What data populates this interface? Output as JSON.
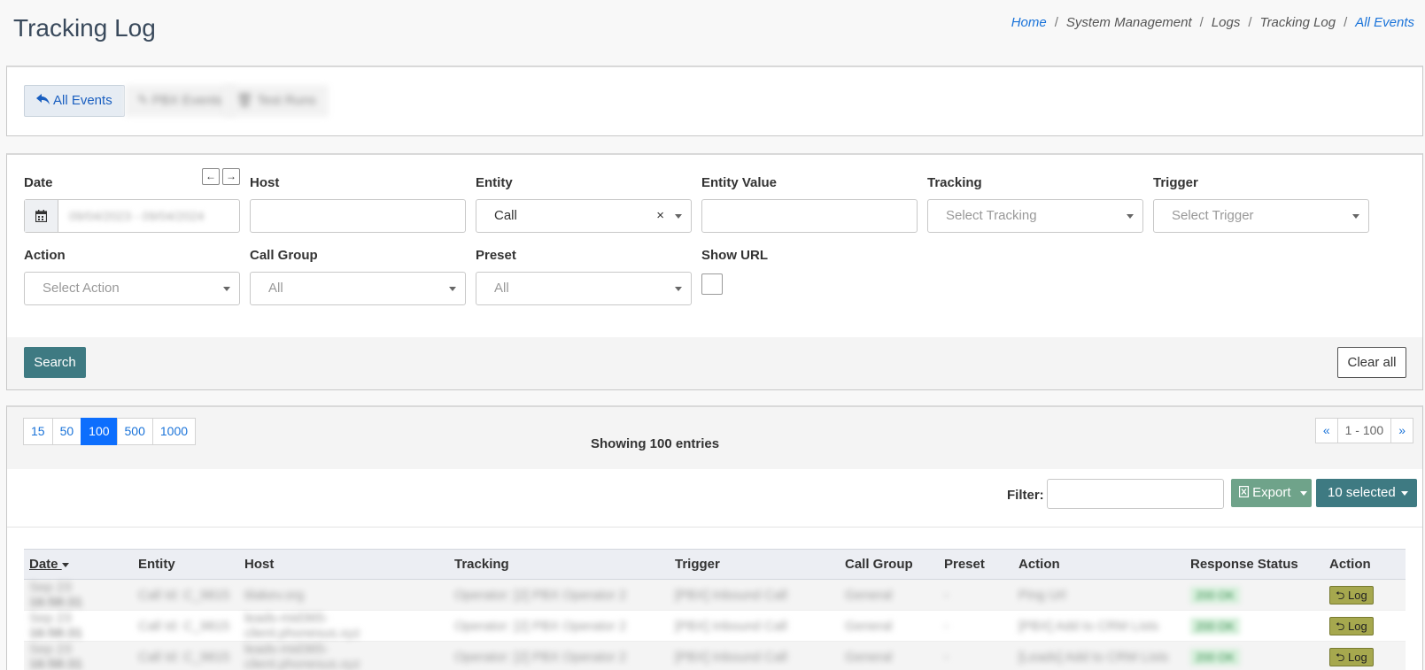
{
  "header": {
    "title": "Tracking Log",
    "breadcrumb": [
      {
        "label": "Home",
        "link": true
      },
      {
        "label": "System Management",
        "link": false
      },
      {
        "label": "Logs",
        "link": false
      },
      {
        "label": "Tracking Log",
        "link": false
      },
      {
        "label": "All Events",
        "link": true
      }
    ]
  },
  "tabs": [
    {
      "label": "All Events",
      "icon": "reply-icon",
      "active": true
    },
    {
      "label": "PBX Events",
      "icon": "wrench-icon",
      "active": false
    },
    {
      "label": "Test Runs",
      "icon": "trash-icon",
      "active": false
    }
  ],
  "filters": {
    "date": {
      "label": "Date",
      "value": "09/04/2023 - 09/04/2024"
    },
    "host": {
      "label": "Host",
      "value": ""
    },
    "entity": {
      "label": "Entity",
      "value": "Call"
    },
    "entity_value": {
      "label": "Entity Value",
      "value": ""
    },
    "tracking": {
      "label": "Tracking",
      "placeholder": "Select Tracking"
    },
    "trigger": {
      "label": "Trigger",
      "placeholder": "Select Trigger"
    },
    "action": {
      "label": "Action",
      "placeholder": "Select Action"
    },
    "call_group": {
      "label": "Call Group",
      "value": "All"
    },
    "preset": {
      "label": "Preset",
      "value": "All"
    },
    "show_url": {
      "label": "Show URL",
      "checked": false
    },
    "search_label": "Search",
    "clear_label": "Clear all"
  },
  "table_controls": {
    "page_sizes": [
      "15",
      "50",
      "100",
      "500",
      "1000"
    ],
    "active_page_size": "100",
    "showing": "Showing 100 entries",
    "pagination": {
      "prev": "«",
      "range": "1 - 100",
      "next": "»"
    },
    "filter_label": "Filter:",
    "export_label": "Export",
    "selected_label": "10 selected"
  },
  "table": {
    "columns": [
      "Date",
      "Entity",
      "Host",
      "Tracking",
      "Trigger",
      "Call Group",
      "Preset",
      "Action",
      "Response Status",
      "Action"
    ],
    "rows": [
      {
        "date": "Sep 23",
        "time": "16:58:31",
        "entity": "Call Id: C_9815",
        "host": "tilakev.org",
        "tracking": "Operator: [2] PBX Operator 2",
        "trigger": "[PBX] Inbound Call",
        "call_group": "General",
        "preset": "-",
        "action": "Ping Url",
        "status": "200 OK",
        "log_label": "Log"
      },
      {
        "date": "Sep 23",
        "time": "16:58:31",
        "entity": "Call Id: C_9815",
        "host": "leads-mid365-client.phonesus.xyz",
        "tracking": "Operator: [2] PBX Operator 2",
        "trigger": "[PBX] Inbound Call",
        "call_group": "General",
        "preset": "-",
        "action": "[PBX] Add to CRM Lists",
        "status": "200 OK",
        "log_label": "Log"
      },
      {
        "date": "Sep 23",
        "time": "16:58:31",
        "entity": "Call Id: C_9815",
        "host": "leads-mid365-client.phonesus.xyz",
        "tracking": "Operator: [2] PBX Operator 2",
        "trigger": "[PBX] Inbound Call",
        "call_group": "General",
        "preset": "-",
        "action": "[Leads] Add to CRM Lists",
        "status": "200 OK",
        "log_label": "Log"
      }
    ]
  }
}
